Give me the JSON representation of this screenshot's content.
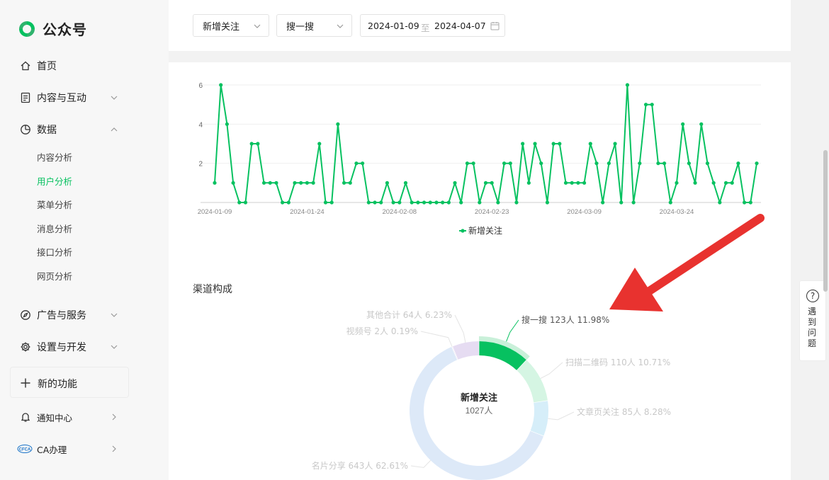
{
  "app": {
    "title": "公众号"
  },
  "sidebar": {
    "items": [
      {
        "label": "首页",
        "icon": "home-icon"
      },
      {
        "label": "内容与互动",
        "icon": "document-icon"
      },
      {
        "label": "数据",
        "icon": "clock-chart-icon"
      },
      {
        "label": "广告与服务",
        "icon": "compass-icon"
      },
      {
        "label": "设置与开发",
        "icon": "gear-icon"
      }
    ],
    "data_sub": [
      "内容分析",
      "用户分析",
      "菜单分析",
      "消息分析",
      "接口分析",
      "网页分析"
    ],
    "active_sub": "用户分析",
    "new_feature": "新的功能",
    "notify": "通知中心",
    "ca": "CA办理",
    "ca_badge": "CFCA"
  },
  "filters": {
    "metric": "新增关注",
    "source": "搜一搜",
    "date_from": "2024-01-09",
    "date_sep": "至",
    "date_to": "2024-04-07"
  },
  "colors": {
    "accent": "#07c160",
    "arrow": "#e8322f"
  },
  "chart_data": [
    {
      "type": "line",
      "title": "",
      "xlabel": "",
      "ylabel": "",
      "x_tick_labels": [
        "2024-01-09",
        "2024-01-24",
        "2024-02-08",
        "2024-02-23",
        "2024-03-09",
        "2024-03-24"
      ],
      "y_ticks": [
        2,
        4,
        6
      ],
      "ylim": [
        0,
        6
      ],
      "grid": true,
      "legend": "bottom",
      "series": [
        {
          "name": "新增关注",
          "start_date": "2024-01-09",
          "values": [
            1,
            6,
            4,
            1,
            0,
            0,
            3,
            3,
            1,
            1,
            1,
            0,
            0,
            1,
            1,
            1,
            1,
            3,
            0,
            0,
            4,
            1,
            1,
            2,
            2,
            0,
            0,
            0,
            1,
            0,
            0,
            1,
            0,
            0,
            0,
            0,
            0,
            0,
            0,
            1,
            0,
            2,
            2,
            0,
            1,
            1,
            0,
            2,
            2,
            0,
            3,
            1,
            3,
            2,
            0,
            3,
            3,
            1,
            1,
            1,
            1,
            3,
            2,
            0,
            2,
            3,
            0,
            6,
            0,
            2,
            5,
            5,
            2,
            2,
            0,
            1,
            4,
            2,
            1,
            4,
            2,
            1,
            0,
            1,
            1,
            2,
            0,
            0,
            2
          ]
        }
      ]
    },
    {
      "type": "pie",
      "title": "渠道构成",
      "center_label": "新增关注",
      "center_value": "1027人",
      "highlight": "搜一搜",
      "slices": [
        {
          "name": "搜一搜",
          "value": 123,
          "label": "搜一搜 123人 11.98%"
        },
        {
          "name": "扫描二维码",
          "value": 110,
          "label": "扫描二维码 110人 10.71%"
        },
        {
          "name": "文章页关注",
          "value": 85,
          "label": "文章页关注 85人 8.28%"
        },
        {
          "name": "名片分享",
          "value": 643,
          "label": "名片分享 643人 62.61%"
        },
        {
          "name": "视频号",
          "value": 2,
          "label": "视频号 2人 0.19%"
        },
        {
          "name": "其他合计",
          "value": 64,
          "label": "其他合计 64人 6.23%"
        }
      ]
    }
  ],
  "help": {
    "text": "遇到问题"
  }
}
